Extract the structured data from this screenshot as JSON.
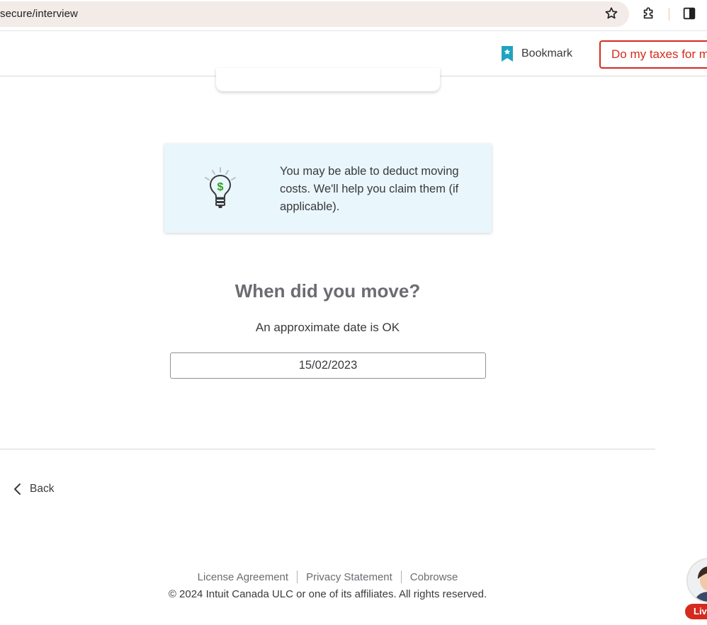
{
  "browser": {
    "url": "secure/interview"
  },
  "header": {
    "bookmark_label": "Bookmark",
    "expert_button_label": "Do my taxes for m"
  },
  "info": {
    "text": "You may be able to deduct moving costs. We'll help you claim them (if applicable)."
  },
  "question": {
    "title": "When did you move?",
    "subtitle": "An approximate date is OK",
    "date_value": "15/02/2023"
  },
  "nav": {
    "back_label": "Back"
  },
  "footer": {
    "links": [
      "License Agreement",
      "Privacy Statement",
      "Cobrowse"
    ],
    "copyright": "© 2024 Intuit Canada ULC or one of its affiliates. All rights reserved."
  },
  "live_chat": {
    "badge_label": "Liv"
  },
  "colors": {
    "accent_red": "#d52b1e",
    "bookmark_teal": "#1fa4c0",
    "info_bg": "#e9f6fb",
    "dollar_green": "#2ca01c"
  }
}
